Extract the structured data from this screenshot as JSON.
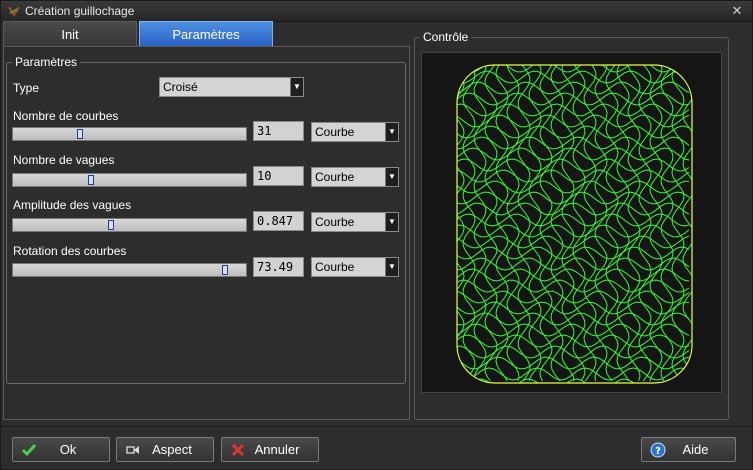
{
  "window": {
    "title": "Création guillochage",
    "close_glyph": "✕",
    "app_icon": "guilloche-app-icon"
  },
  "tabs": [
    {
      "label": "Init",
      "active": false
    },
    {
      "label": "Paramètres",
      "active": true
    }
  ],
  "params": {
    "group_label": "Paramètres",
    "type_label": "Type",
    "type_value": "Croisé",
    "rows": [
      {
        "label": "Nombre de courbes",
        "value": "31",
        "mode": "Courbe",
        "slider_fraction": 0.28
      },
      {
        "label": "Nombre de vagues",
        "value": "10",
        "mode": "Courbe",
        "slider_fraction": 0.33
      },
      {
        "label": "Amplitude des vagues",
        "value": "0.847",
        "mode": "Courbe",
        "slider_fraction": 0.42
      },
      {
        "label": "Rotation des courbes",
        "value": "73.49",
        "mode": "Courbe",
        "slider_fraction": 0.92
      }
    ]
  },
  "control": {
    "label": "Contrôle",
    "curve_color": "#33ff33"
  },
  "buttons": {
    "ok": {
      "label": "Ok",
      "icon": "check-icon"
    },
    "aspect": {
      "label": "Aspect",
      "icon": "aspect-icon"
    },
    "cancel": {
      "label": "Annuler",
      "icon": "cancel-x-icon"
    },
    "help": {
      "label": "Aide",
      "icon": "help-icon"
    }
  },
  "colors": {
    "accent": "#3a78d8",
    "background": "#2d2d2d"
  }
}
